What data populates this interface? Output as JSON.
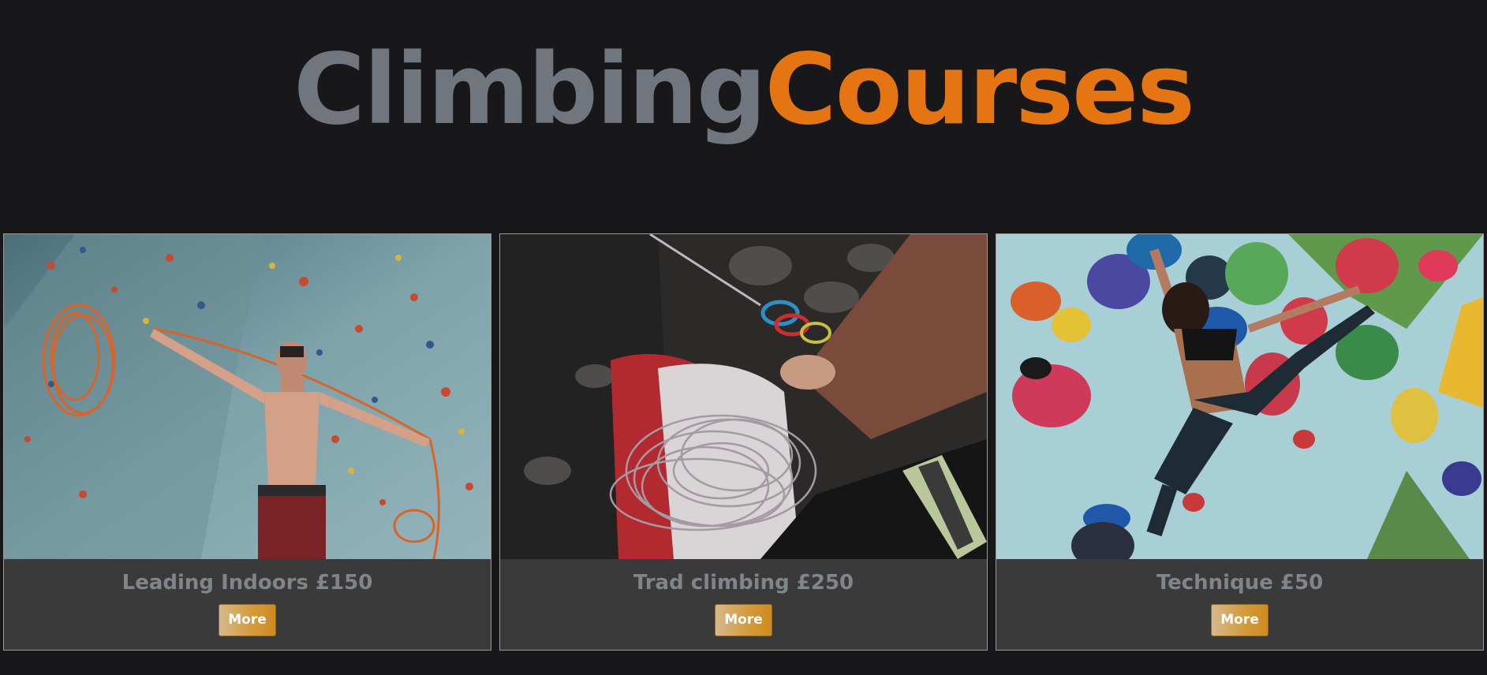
{
  "header": {
    "title_part1": "Climbing",
    "title_part2": "Courses"
  },
  "colors": {
    "background": "#18181b",
    "title_gray": "#71757d",
    "accent_orange": "#e57412",
    "card_background": "#3a3a3a",
    "caption_gray": "#80848b"
  },
  "courses": [
    {
      "caption": "Leading Indoors £150",
      "button_label": "More",
      "image": "indoor-climbing-wall-rope-photo"
    },
    {
      "caption": "Trad climbing £250",
      "button_label": "More",
      "image": "trad-climbing-rope-harness-photo"
    },
    {
      "caption": "Technique £50",
      "button_label": "More",
      "image": "bouldering-wall-climber-photo"
    }
  ]
}
